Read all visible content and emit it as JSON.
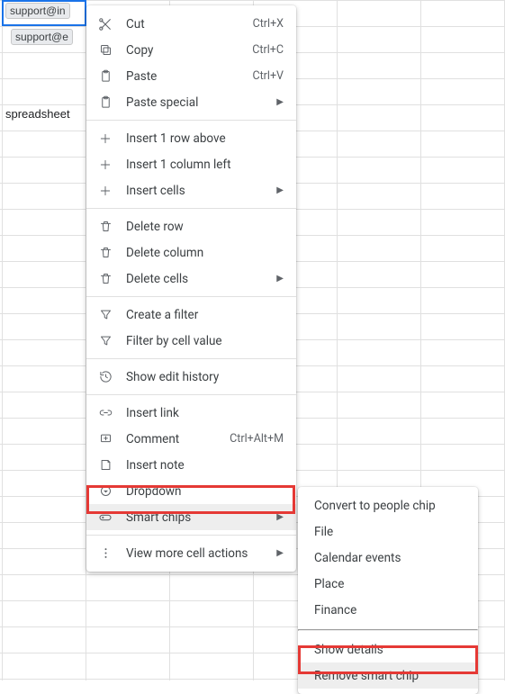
{
  "cells": {
    "a1_chip": "support@in",
    "a2_chip": "support@e",
    "a5": "spreadsheet"
  },
  "menu": {
    "cut": {
      "label": "Cut",
      "shortcut": "Ctrl+X"
    },
    "copy": {
      "label": "Copy",
      "shortcut": "Ctrl+C"
    },
    "paste": {
      "label": "Paste",
      "shortcut": "Ctrl+V"
    },
    "paste_special": {
      "label": "Paste special"
    },
    "insert_row": {
      "label": "Insert 1 row above"
    },
    "insert_col": {
      "label": "Insert 1 column left"
    },
    "insert_cells": {
      "label": "Insert cells"
    },
    "delete_row": {
      "label": "Delete row"
    },
    "delete_col": {
      "label": "Delete column"
    },
    "delete_cells": {
      "label": "Delete cells"
    },
    "create_filter": {
      "label": "Create a filter"
    },
    "filter_value": {
      "label": "Filter by cell value"
    },
    "edit_history": {
      "label": "Show edit history"
    },
    "insert_link": {
      "label": "Insert link"
    },
    "comment": {
      "label": "Comment",
      "shortcut": "Ctrl+Alt+M"
    },
    "insert_note": {
      "label": "Insert note"
    },
    "dropdown": {
      "label": "Dropdown"
    },
    "smart_chips": {
      "label": "Smart chips"
    },
    "more_actions": {
      "label": "View more cell actions"
    }
  },
  "submenu": {
    "people": {
      "label": "Convert to people chip"
    },
    "file": {
      "label": "File"
    },
    "calendar": {
      "label": "Calendar events"
    },
    "place": {
      "label": "Place"
    },
    "finance": {
      "label": "Finance"
    },
    "details": {
      "label": "Show details"
    },
    "remove": {
      "label": "Remove smart chip"
    }
  }
}
